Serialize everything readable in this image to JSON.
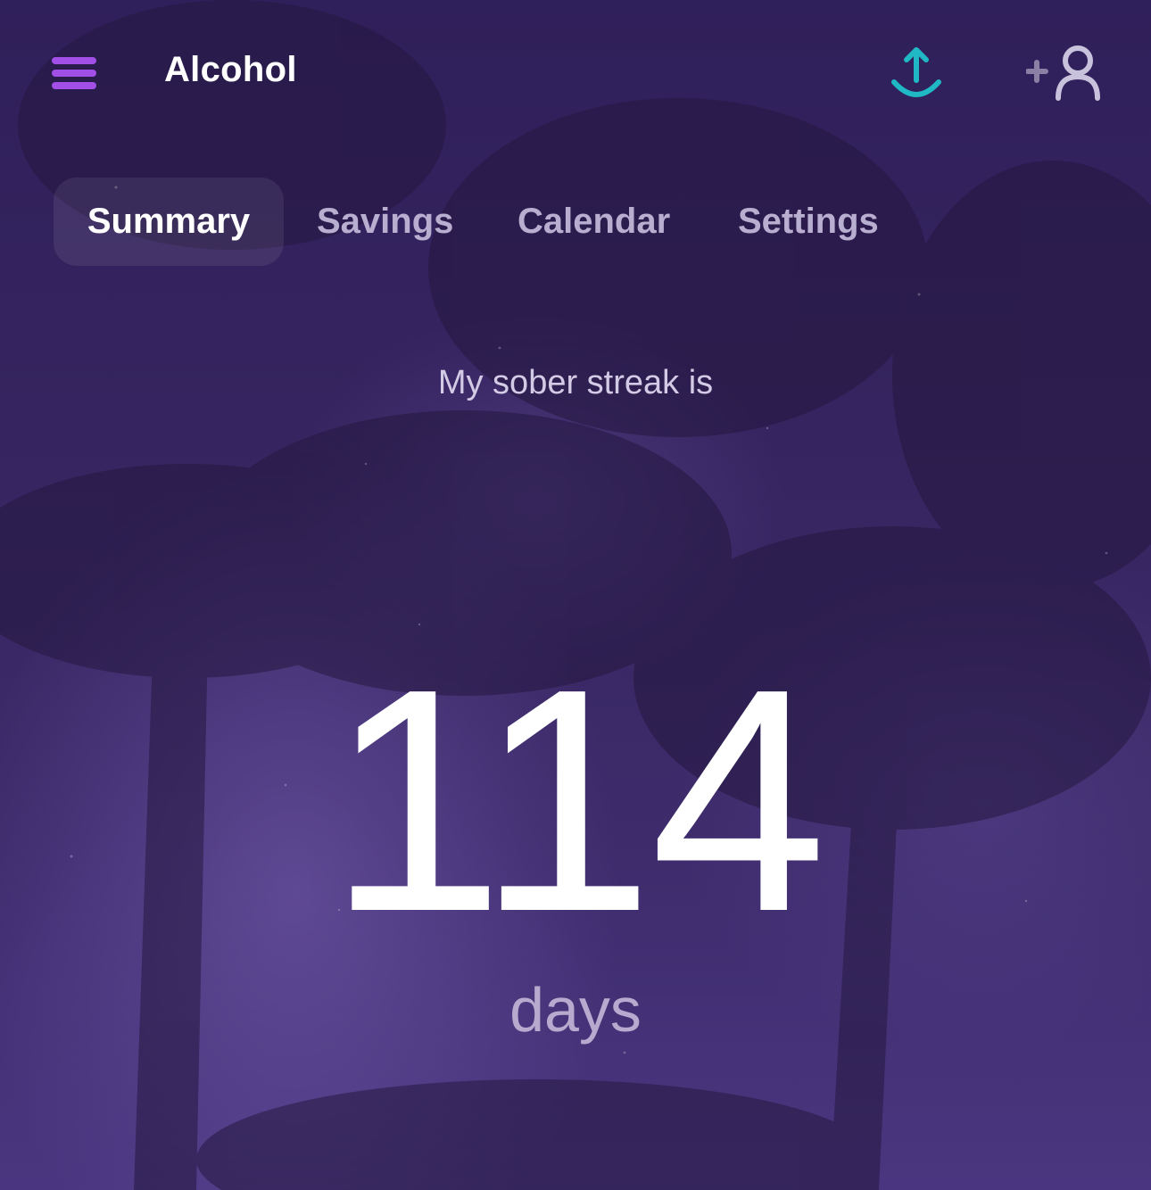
{
  "header": {
    "title": "Alcohol",
    "menu_icon": "hamburger-menu-icon",
    "upload_icon": "upload-icon",
    "add_user_icon": "add-user-icon"
  },
  "tabs": [
    {
      "label": "Summary",
      "active": true
    },
    {
      "label": "Savings",
      "active": false
    },
    {
      "label": "Calendar",
      "active": false
    },
    {
      "label": "Settings",
      "active": false
    }
  ],
  "summary": {
    "label": "My sober streak is",
    "value": "114",
    "unit": "days"
  },
  "colors": {
    "accent": "#a24fe8",
    "upload": "#1fb8c4",
    "background": "#3a2668"
  }
}
